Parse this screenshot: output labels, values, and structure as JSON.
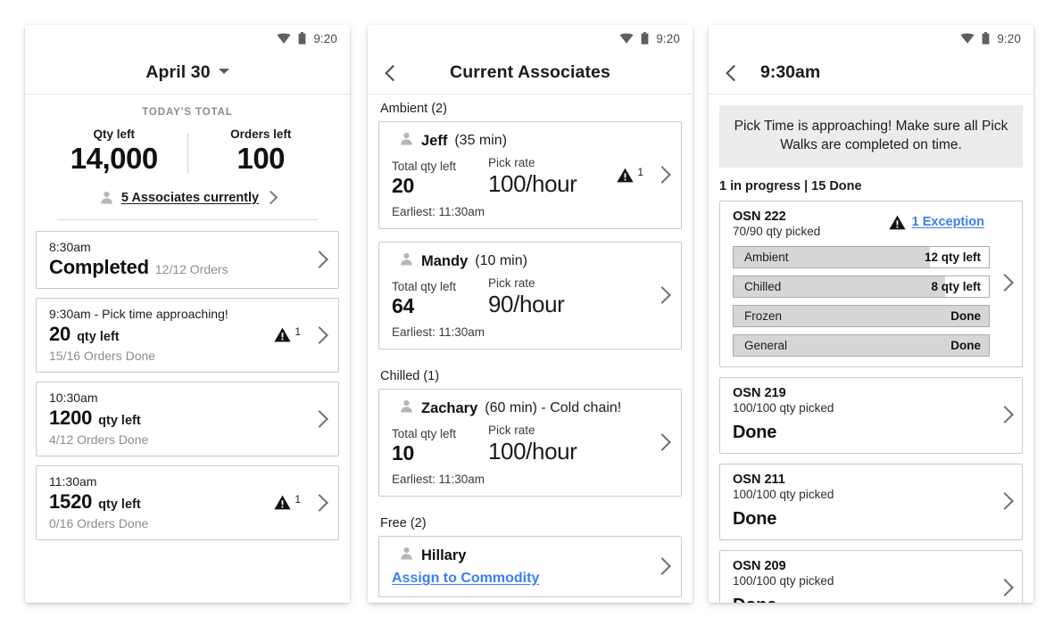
{
  "statusbar": {
    "time": "9:20",
    "wifi_icon": "wifi-icon",
    "battery_icon": "battery-icon"
  },
  "colors": {
    "link_blue": "#3b7ef5",
    "bar_fill": "#d6d6d6",
    "banner_bg": "#ececec",
    "text": "#1b1b1b",
    "muted": "#8d8d8d"
  },
  "panel1": {
    "title": "April 30",
    "dropdown_icon": "chevron-down-icon",
    "totals": {
      "heading": "TODAY'S TOTAL",
      "qty_label": "Qty left",
      "qty_value": "14,000",
      "orders_label": "Orders left",
      "orders_value": "100"
    },
    "associates_link": "5 Associates currently",
    "cards": [
      {
        "time": "8:30am",
        "status": "Completed",
        "status_sub": "12/12 Orders",
        "big": "",
        "unit": "",
        "sub": "",
        "warn": null
      },
      {
        "time": "9:30am - Pick time approaching!",
        "status": "",
        "status_sub": "",
        "big": "20",
        "unit": "qty left",
        "sub": "15/16 Orders Done",
        "warn": "1"
      },
      {
        "time": "10:30am",
        "status": "",
        "status_sub": "",
        "big": "1200",
        "unit": "qty left",
        "sub": "4/12 Orders Done",
        "warn": null
      },
      {
        "time": "11:30am",
        "status": "",
        "status_sub": "",
        "big": "1520",
        "unit": "qty left",
        "sub": "0/16 Orders Done",
        "warn": "1"
      }
    ]
  },
  "panel2": {
    "title": "Current Associates",
    "back_icon": "back-chevron-icon",
    "sections": [
      {
        "heading": "Ambient (2)",
        "associates": [
          {
            "name": "Jeff",
            "meta": "(35 min)",
            "qty_label": "Total qty left",
            "qty_value": "20",
            "rate_label": "Pick rate",
            "rate_value": "100/hour",
            "earliest": "Earliest: 11:30am",
            "warn": "1",
            "link": null
          },
          {
            "name": "Mandy",
            "meta": "(10 min)",
            "qty_label": "Total qty left",
            "qty_value": "64",
            "rate_label": "Pick rate",
            "rate_value": "90/hour",
            "earliest": "Earliest: 11:30am",
            "warn": null,
            "link": null
          }
        ]
      },
      {
        "heading": "Chilled (1)",
        "associates": [
          {
            "name": "Zachary",
            "meta": "(60 min) - Cold chain!",
            "qty_label": "Total qty left",
            "qty_value": "10",
            "rate_label": "Pick rate",
            "rate_value": "100/hour",
            "earliest": "Earliest: 11:30am",
            "warn": null,
            "link": null
          }
        ]
      },
      {
        "heading": "Free (2)",
        "associates": [
          {
            "name": "Hillary",
            "meta": "",
            "qty_label": "",
            "qty_value": "",
            "rate_label": "",
            "rate_value": "",
            "earliest": "",
            "warn": null,
            "link": "Assign to Commodity"
          }
        ]
      }
    ]
  },
  "panel3": {
    "title": "9:30am",
    "back_icon": "back-chevron-icon",
    "banner": "Pick Time is approaching! Make sure all Pick Walks are completed on time.",
    "progress_line": "1 in progress | 15 Done",
    "orders": [
      {
        "id": "OSN 222",
        "sub": "70/90 qty picked",
        "exception": "1 Exception",
        "warn": true,
        "done": "",
        "bars": [
          {
            "label": "Ambient",
            "value": "12 qty left",
            "fill_pct": 77
          },
          {
            "label": "Chilled",
            "value": "8 qty left",
            "fill_pct": 83
          },
          {
            "label": "Frozen",
            "value": "Done",
            "fill_pct": 100
          },
          {
            "label": "General",
            "value": "Done",
            "fill_pct": 100
          }
        ]
      },
      {
        "id": "OSN 219",
        "sub": "100/100 qty picked",
        "exception": null,
        "warn": false,
        "done": "Done",
        "bars": []
      },
      {
        "id": "OSN 211",
        "sub": "100/100 qty picked",
        "exception": null,
        "warn": false,
        "done": "Done",
        "bars": []
      },
      {
        "id": "OSN 209",
        "sub": "100/100 qty picked",
        "exception": null,
        "warn": false,
        "done": "Done",
        "bars": []
      }
    ]
  }
}
